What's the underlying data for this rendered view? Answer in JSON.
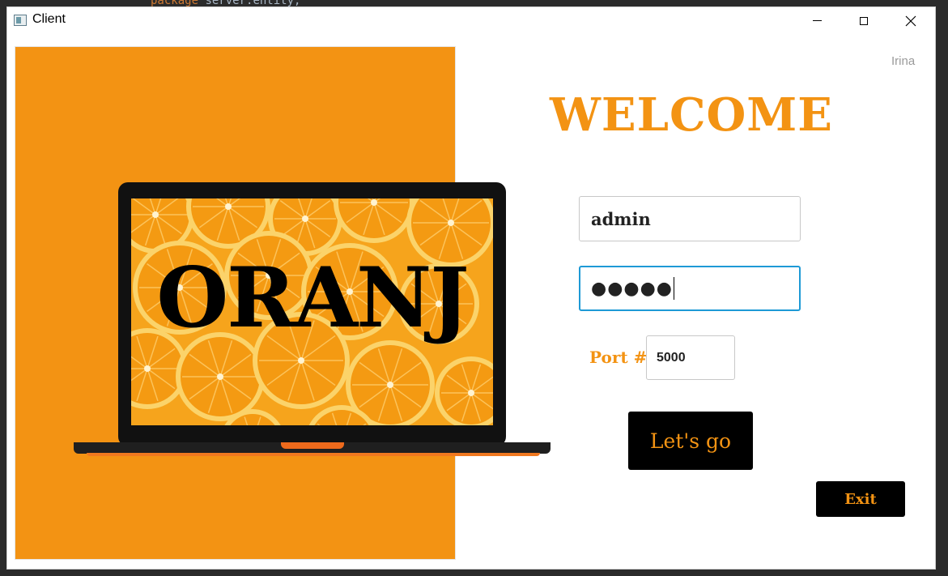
{
  "background_editor": {
    "code_keyword": "package",
    "code_rest": " server.entity;"
  },
  "window": {
    "title": "Client",
    "minimize_glyph": "",
    "close_glyph": "✕"
  },
  "header": {
    "user": "Irina",
    "welcome": "WELCOME"
  },
  "brand": {
    "name": "ORANJ"
  },
  "form": {
    "username_value": "admin",
    "password_mask": "●●●●●",
    "port_label": "Port #",
    "port_value": "5000"
  },
  "buttons": {
    "go_label": "Let's go",
    "exit_label": "Exit"
  },
  "colors": {
    "accent": "#f39313",
    "focus": "#1e9ad6",
    "button_bg": "#000000"
  }
}
